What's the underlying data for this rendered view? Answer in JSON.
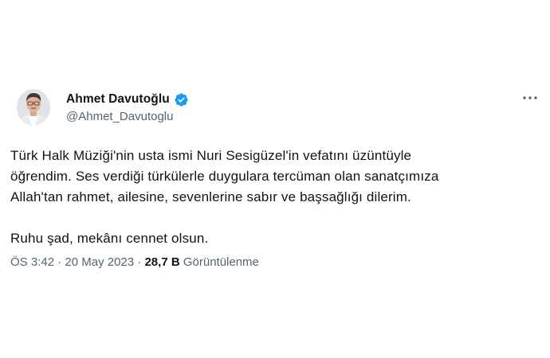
{
  "author": {
    "display_name": "Ahmet Davutoğlu",
    "handle": "@Ahmet_Davutoglu",
    "verified": true,
    "verified_color": "#1d9bf0",
    "avatar_icon": "person-portrait-icon"
  },
  "menu": {
    "more_icon": "more-horizontal-icon"
  },
  "tweet": {
    "paragraph_1_line_1": "Türk Halk Müziği'nin usta ismi Nuri Sesigüzel'in vefatını üzüntüyle",
    "paragraph_1_line_2": "öğrendim. Ses verdiği türkülerle duygulara tercüman olan sanatçımıza",
    "paragraph_1_line_3": "Allah'tan rahmet, ailesine, sevenlerine sabır ve başsağlığı dilerim.",
    "paragraph_2": "Ruhu şad, mekânı cennet olsun."
  },
  "meta": {
    "time": "ÖS 3:42",
    "separator": " · ",
    "date": "20 May 2023",
    "views_count": "28,7 B",
    "views_label": "Görüntülenme"
  }
}
